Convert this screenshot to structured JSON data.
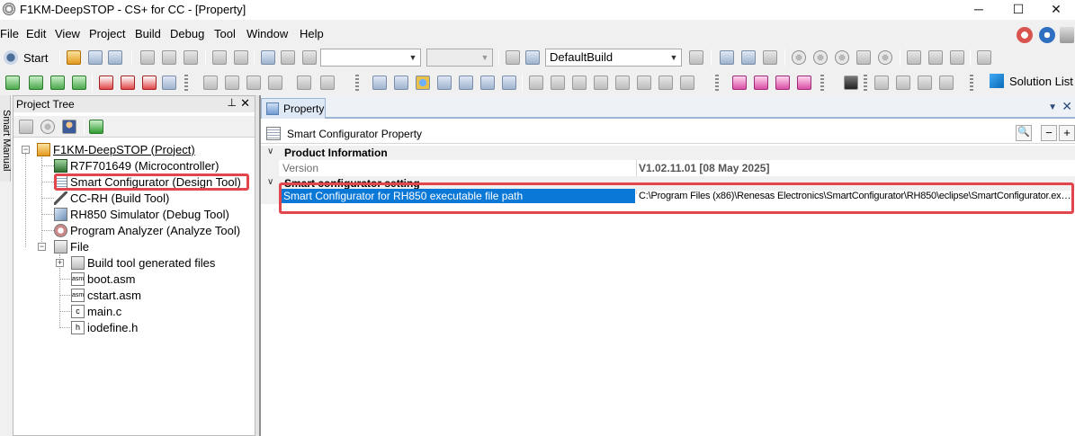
{
  "window": {
    "title": "F1KM-DeepSTOP - CS+ for CC - [Property]",
    "minimize": "─",
    "maximize": "☐",
    "close": "✕"
  },
  "menu": {
    "items": [
      "File",
      "Edit",
      "View",
      "Project",
      "Build",
      "Debug",
      "Tool",
      "Window",
      "Help"
    ]
  },
  "toolbar": {
    "start_label": "Start",
    "build_mode": "DefaultBuild",
    "solution_list_label": "Solution List"
  },
  "side_tab": {
    "label": "Smart Manual"
  },
  "project_tree": {
    "title": "Project Tree",
    "pin": "⊥",
    "close": "✕",
    "nodes": {
      "project": "F1KM-DeepSTOP (Project)",
      "micro": "R7F701649 (Microcontroller)",
      "smart_configurator": "Smart Configurator (Design Tool)",
      "build_tool": "CC-RH (Build Tool)",
      "debug_tool": "RH850 Simulator (Debug Tool)",
      "analyze_tool": "Program Analyzer (Analyze Tool)",
      "file": "File",
      "build_generated": "Build tool generated files",
      "boot": "boot.asm",
      "cstart": "cstart.asm",
      "main": "main.c",
      "iodefine": "iodefine.h"
    },
    "file_badges": {
      "asm": "asm",
      "c": "c",
      "h": "h"
    }
  },
  "property": {
    "tab_label": "Property",
    "header": "Smart Configurator Property",
    "search_icon": "🔍",
    "collapse_btn": "−",
    "expand_btn": "+",
    "categories": [
      {
        "label": "Product Information",
        "rows": [
          {
            "name": "Version",
            "value": "V1.02.11.01 [08 May 2025]"
          }
        ]
      },
      {
        "label": "Smart configurator setting",
        "rows": [
          {
            "name": "Smart Configurator for RH850 executable file path",
            "value": "C:\\Program Files (x86)\\Renesas Electronics\\SmartConfigurator\\RH850\\eclipse\\SmartConfigurator.ex…"
          }
        ]
      }
    ]
  },
  "colors": {
    "highlight_box": "#e0464c",
    "selection": "#0a78d7"
  }
}
